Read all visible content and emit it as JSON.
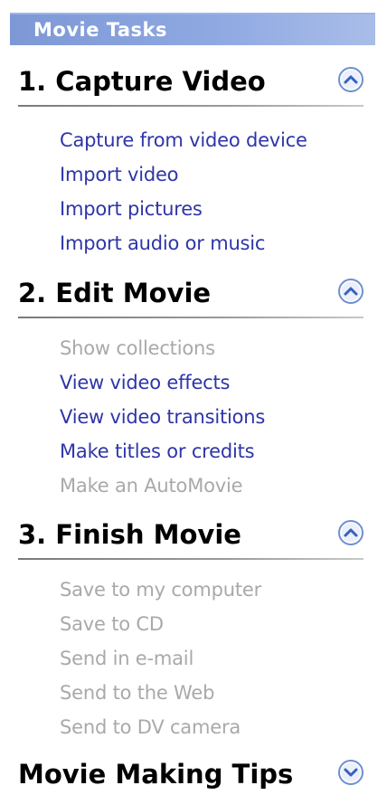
{
  "pane_title": "Movie Tasks",
  "sections": [
    {
      "title": "1. Capture Video",
      "expanded": true,
      "tasks": [
        {
          "label": "Capture from video device",
          "enabled": true
        },
        {
          "label": "Import video",
          "enabled": true
        },
        {
          "label": "Import pictures",
          "enabled": true
        },
        {
          "label": "Import audio or music",
          "enabled": true
        }
      ]
    },
    {
      "title": "2. Edit Movie",
      "expanded": true,
      "tasks": [
        {
          "label": "Show collections",
          "enabled": false
        },
        {
          "label": "View video effects",
          "enabled": true
        },
        {
          "label": "View video transitions",
          "enabled": true
        },
        {
          "label": "Make titles or credits",
          "enabled": true
        },
        {
          "label": "Make an AutoMovie",
          "enabled": false
        }
      ]
    },
    {
      "title": "3. Finish Movie",
      "expanded": true,
      "tasks": [
        {
          "label": "Save to my computer",
          "enabled": false
        },
        {
          "label": "Save to CD",
          "enabled": false
        },
        {
          "label": "Send in e-mail",
          "enabled": false
        },
        {
          "label": "Send to the Web",
          "enabled": false
        },
        {
          "label": "Send to DV camera",
          "enabled": false
        }
      ]
    },
    {
      "title": "Movie Making Tips",
      "expanded": false,
      "tasks": []
    }
  ],
  "colors": {
    "link": "#2e35a8",
    "disabled": "#a9a9a9",
    "title_bar": "#8ea8e2",
    "chevron": "#3a5fbf"
  },
  "icons": {
    "collapse": "chevron-up-icon",
    "expand": "chevron-down-icon"
  }
}
